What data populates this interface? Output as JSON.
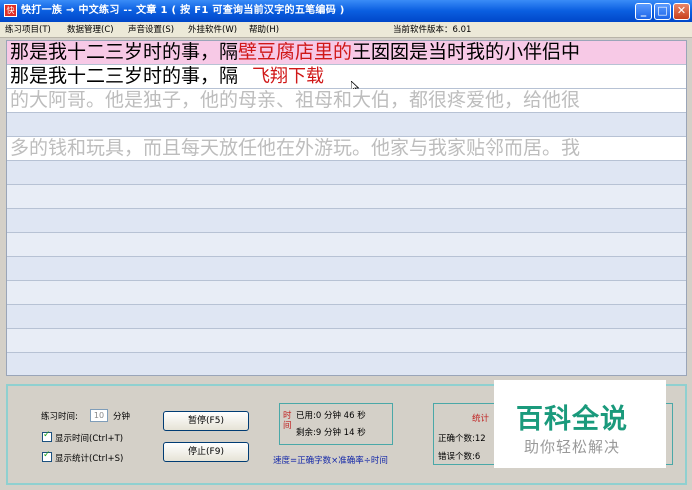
{
  "window": {
    "title": "快打一族 → 中文练习 -- 文章 1      ( 按 F1 可查询当前汉字的五笔编码 )",
    "icon_glyph": "快",
    "buttons": {
      "minimize": "_",
      "maximize": "□",
      "close": "✕"
    }
  },
  "menu": {
    "items": [
      "练习项目(T)",
      "数据管理(C)",
      "声音设置(S)",
      "外挂软件(W)",
      "帮助(H)"
    ],
    "version_label": "当前软件版本：6.01"
  },
  "practice": {
    "line1_pre": "那是我十二三岁时的事，隔",
    "line1_highlight": "壁豆腐店里的",
    "line1_post": "王囡囡是当时我的小伴侣中",
    "line2_typed": "那是我十二三岁时的事，隔",
    "line2_ime": "飞翔下载",
    "line3": "的大阿哥。他是独子，他的母亲、祖母和大伯，都很疼爱他，给他很",
    "line5": "多的钱和玩具，而且每天放任他在外游玩。他家与我家贴邻而居。我"
  },
  "controls": {
    "practice_time_label": "练习时间:",
    "practice_time_value": "10",
    "practice_time_unit": "分钟",
    "show_time_label": "显示时间(Ctrl+T)",
    "show_stats_label": "显示统计(Ctrl+S)",
    "pause_button": "暂停(F5)",
    "stop_button": "停止(F9)"
  },
  "timing": {
    "label": "时间",
    "used": "已用:0 分钟 46 秒",
    "remaining": "剩余:9 分钟 14 秒",
    "formula": "速度=正确字数×准确率÷时间"
  },
  "stats": {
    "title": "统计",
    "correct": "正确个数:12",
    "errors": "错误个数:6"
  },
  "watermark": {
    "main": "百科全说",
    "sub": "助你轻松解决"
  },
  "colors": {
    "title_bar": "#0a5ee0",
    "highlight_line": "#f7c9e6",
    "highlight_text": "#d01818",
    "pending_text": "#bdbdbd",
    "watermark": "#1a9a7c"
  }
}
